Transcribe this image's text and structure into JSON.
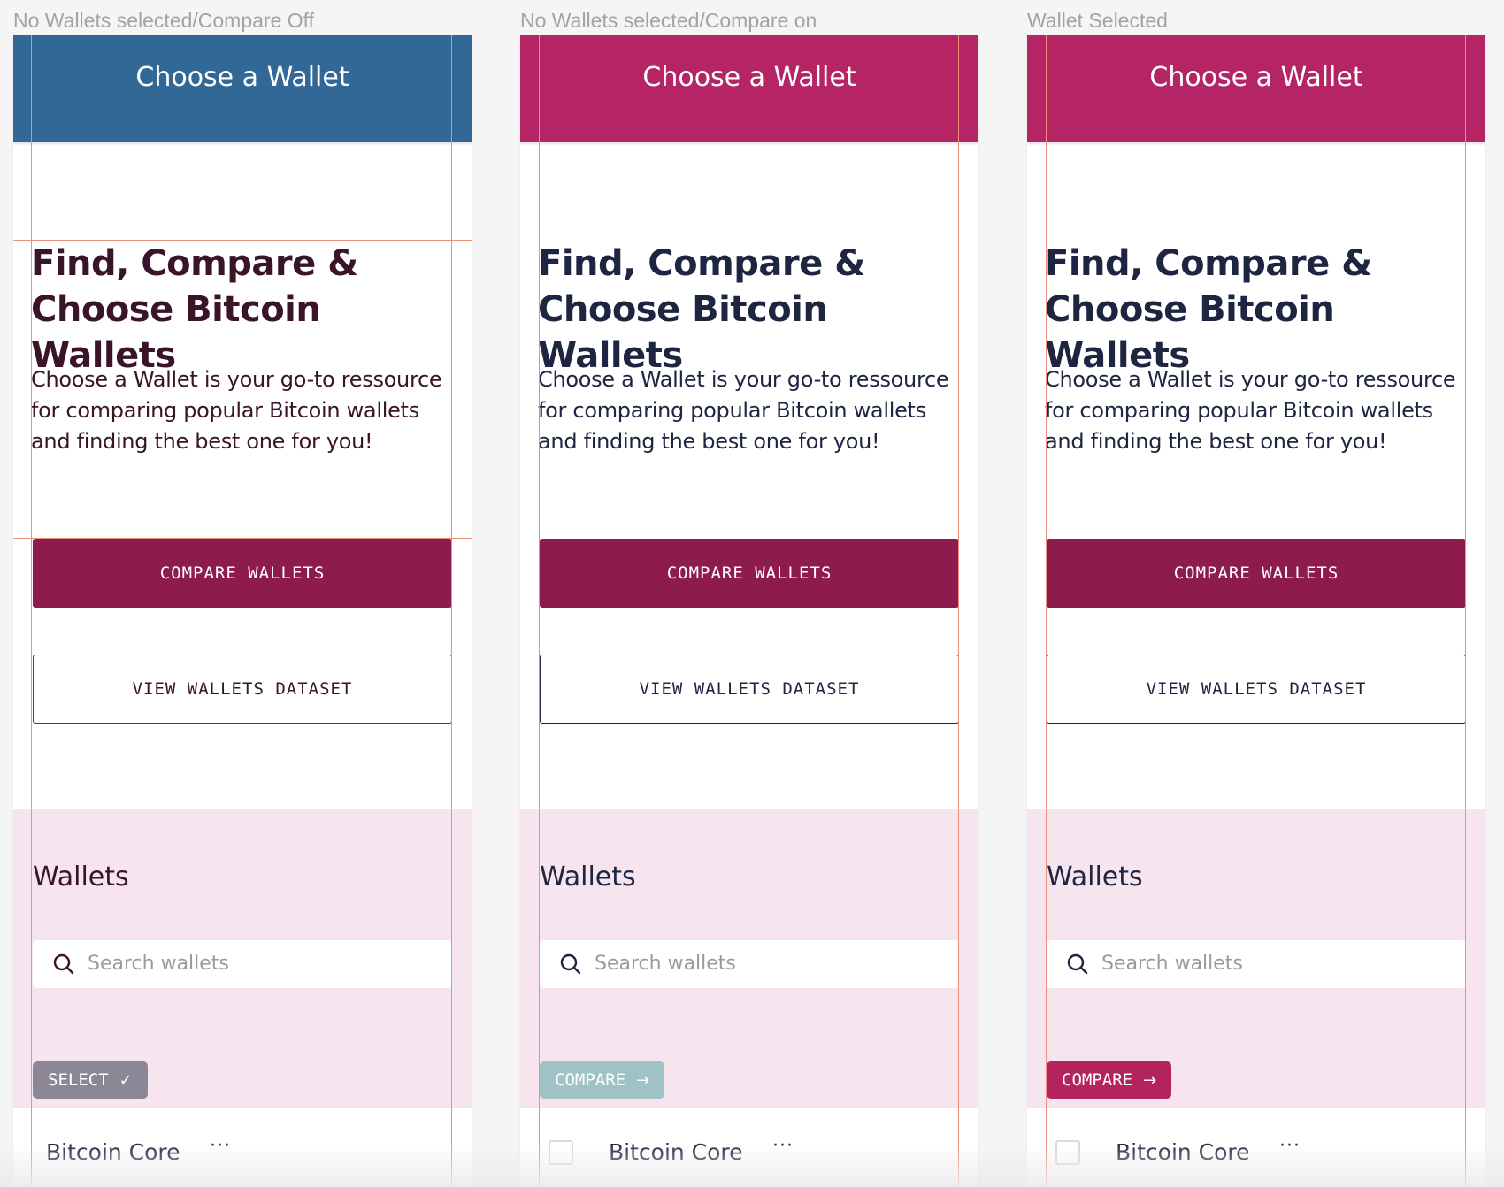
{
  "colors": {
    "canvas_bg": "#f5f5f5",
    "header_blue": "#316896",
    "header_magenta": "#b52565",
    "primary_button": "#8e1b4d",
    "wallets_section_bg": "#f6e4ef",
    "chip_select_gray": "#8c8797",
    "chip_compare_disabled": "#9fc2c7",
    "chip_compare_active": "#b5235f",
    "title_dark_purple": "#3a1428",
    "title_dark_navy": "#1d2540",
    "guide_lines": "#ee8f7c"
  },
  "frames": [
    {
      "label": "No Wallets selected/Compare Off",
      "header_title": "Choose a Wallet",
      "hero_title": "Find, Compare & Choose Bitcoin Wallets",
      "hero_description": "Choose a Wallet is your go-to ressource for comparing popular Bitcoin wallets and finding the best one for you!",
      "compare_button": "COMPARE WALLETS",
      "dataset_button": "VIEW WALLETS DATASET",
      "wallets_heading": "Wallets",
      "search_placeholder": "Search wallets",
      "chip_label": "SELECT",
      "chip_icon": "check-icon",
      "chip_glyph": "✓",
      "row_name": "Bitcoin Core",
      "row_more": "···"
    },
    {
      "label": "No Wallets selected/Compare on",
      "header_title": "Choose a Wallet",
      "hero_title": "Find, Compare & Choose Bitcoin Wallets",
      "hero_description": "Choose a Wallet is your go-to ressource for comparing popular Bitcoin wallets and finding the best one for you!",
      "compare_button": "COMPARE WALLETS",
      "dataset_button": "VIEW WALLETS DATASET",
      "wallets_heading": "Wallets",
      "search_placeholder": "Search wallets",
      "chip_label": "COMPARE",
      "chip_icon": "arrow-right-icon",
      "chip_glyph": "→",
      "row_name": "Bitcoin Core",
      "row_more": "···"
    },
    {
      "label": "Wallet Selected",
      "header_title": "Choose a Wallet",
      "hero_title": "Find, Compare & Choose Bitcoin Wallets",
      "hero_description": "Choose a Wallet is your go-to ressource for comparing popular Bitcoin wallets and finding the best one for you!",
      "compare_button": "COMPARE WALLETS",
      "dataset_button": "VIEW WALLETS DATASET",
      "wallets_heading": "Wallets",
      "search_placeholder": "Search wallets",
      "chip_label": "COMPARE",
      "chip_icon": "arrow-right-icon",
      "chip_glyph": "→",
      "row_name": "Bitcoin Core",
      "row_more": "···"
    }
  ]
}
